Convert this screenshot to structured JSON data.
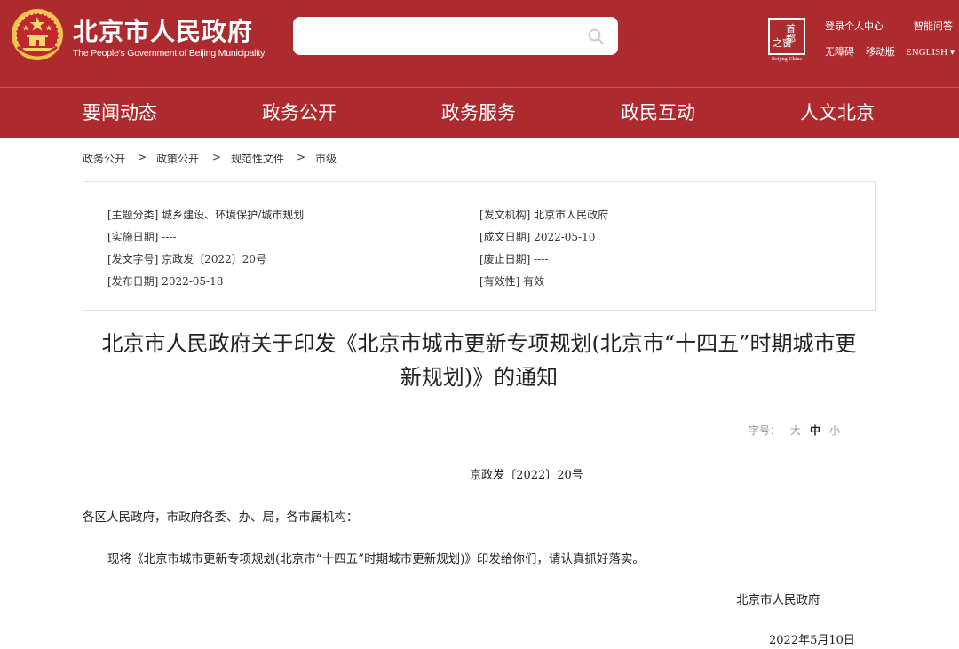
{
  "header": {
    "title": "北京市人民政府",
    "subtitle": "The People's Government of Beijing Municipality",
    "search_placeholder": "",
    "seal_line1": "首都",
    "seal_line2": "之窗",
    "seal_caption": "Beijing-China",
    "links": {
      "login": "登录个人中心",
      "smart_qa": "智能问答",
      "accessibility": "无障碍",
      "mobile": "移动版",
      "english": "ENGLISH ▾"
    }
  },
  "nav": [
    "要闻动态",
    "政务公开",
    "政务服务",
    "政民互动",
    "人文北京"
  ],
  "breadcrumb": {
    "items": [
      "政务公开",
      "政策公开",
      "规范性文件",
      "市级"
    ],
    "separator": ">"
  },
  "metadata": {
    "topic": "[主题分类] 城乡建设、环境保护/城市规划",
    "issuer": "[发文机构] 北京市人民政府",
    "effective_date": "[实施日期] ----",
    "written_date": "[成文日期] 2022-05-10",
    "doc_no": "[发文字号] 京政发〔2022〕20号",
    "repeal_date": "[废止日期] ----",
    "publish_date": "[发布日期] 2022-05-18",
    "validity": "[有效性] 有效"
  },
  "article": {
    "title_line1": "北京市人民政府关于印发《北京市城市更新专项规划(北京市“十四五”时期城市更",
    "title_line2": "新规划)》的通知",
    "font_size": {
      "label": "字号：",
      "large": "大",
      "medium": "中",
      "small": "小"
    },
    "doc_number": "京政发〔2022〕20号",
    "salutation": "各区人民政府，市政府各委、办、局，各市属机构：",
    "body": "现将《北京市城市更新专项规划(北京市“十四五”时期城市更新规划)》印发给你们，请认真抓好落实。",
    "signature": "北京市人民政府",
    "date": "2022年5月10日"
  },
  "colors": {
    "brand_red": "#ad2b2e",
    "emblem_gold": "#f2c14e",
    "border": "#e2e2e2"
  }
}
